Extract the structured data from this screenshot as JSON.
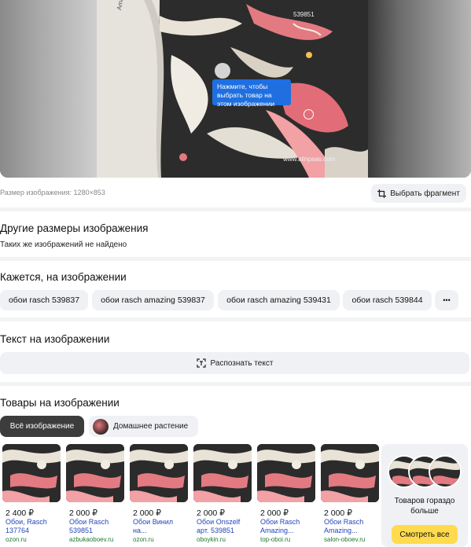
{
  "hero": {
    "watermark": "www.alinpaas.com",
    "code": "539851",
    "roll_text": "Amazing",
    "tooltip": "Нажмите, чтобы выбрать товар на этом изображении"
  },
  "image_size": "Размер изображения: 1280×853",
  "select_fragment": "Выбрать фрагмент",
  "other_sizes": {
    "title": "Другие размеры изображения",
    "empty": "Таких же изображений не найдено"
  },
  "seems": {
    "title": "Кажется, на изображении",
    "chips": [
      "обои rasch 539837",
      "обои rasch amazing 539837",
      "обои rasch amazing 539431",
      "обои rasch 539844"
    ],
    "more": "•••"
  },
  "text_on_image": {
    "title": "Текст на изображении",
    "recognize": "Распознать текст"
  },
  "products": {
    "title": "Товары на изображении",
    "tabs": [
      "Всё изображение",
      "Домашнее растение"
    ],
    "items": [
      {
        "price": "2 400 ₽",
        "title": "Обои, Rasch 137764",
        "site": "ozon.ru"
      },
      {
        "price": "2 000 ₽",
        "title": "Обои Rasch 539851",
        "site": "azbukaoboev.ru"
      },
      {
        "price": "2 000 ₽",
        "title": "Обои Винил на...",
        "site": "ozon.ru"
      },
      {
        "price": "2 000 ₽",
        "title": "Обои Onszelf арт. 539851",
        "site": "oboykin.ru"
      },
      {
        "price": "2 000 ₽",
        "title": "Обои Rasch Amazing...",
        "site": "top-oboi.ru"
      },
      {
        "price": "2 000 ₽",
        "title": "Обои Rasch Amazing...",
        "site": "salon-oboev.ru"
      }
    ],
    "more_text": "Товаров гораздо больше",
    "see_all": "Смотреть все"
  }
}
